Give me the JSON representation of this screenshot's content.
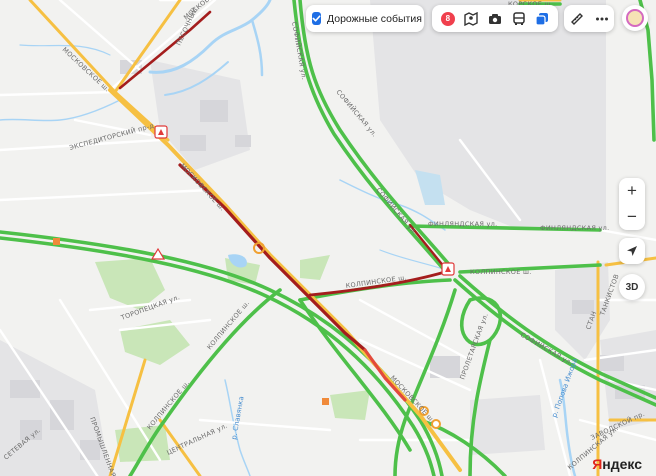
{
  "map": {
    "street_labels": {
      "moskovskoe_1": "МОСКОВСКОЕ ш.",
      "moskovskoe_2": "МОСКОВСКОЕ ш.",
      "moskovskoe_3": "МОСКОВСКОЕ ш.",
      "moskovskoe_top": "МОСКОВСКОЕ",
      "pesochny": "ПЕСОЧНЫЙ",
      "sofiyskaya_1": "СОФИЙСКАЯ ул.",
      "sofiyskaya_2": "СОФИЙСКАЯ ул.",
      "sofiyskaya_3": "СОФИЙСКАЯ ул.",
      "sofiyskaya_4": "СОФИЙСКАЯ ул.",
      "finlyandskaya": "ФИНЛЯНДСКАЯ ул.",
      "finlyandskaya_2": "ФИНЛЯНДСКАЯ ул.",
      "kolpinskoe_1": "КОЛПИНСКОЕ ш.",
      "kolpinskoe_2": "КОЛПИНСКОЕ ш.",
      "kolpinskoe_3": "КОЛПИНСКОЕ ш.",
      "kolpinskoe_4": "КОЛПИНСКОЕ ш.",
      "ekspeditorsky": "ЭКСПЕДИТОРСКИЙ пр-д",
      "toropetskaya": "ТОРОПЕЦКАЯ ул.",
      "promyshlennaya": "ПРОМЫШЛЕННАЯ ул.",
      "setevaya": "СЕТЕВАЯ ул.",
      "proletarskaya": "ПРОЛЕТАРСКАЯ ул.",
      "zavodskoy": "ЗАВОДСКОЙ пр.",
      "lokhanski": "КОЛПИНСКАЯ ул.",
      "tsentralnaya": "ЦЕНТРАЛЬНАЯ ул.",
      "rosh": "КОРСКОЕ ш.",
      "tankistov": "ТАНКИСТОВ",
      "stan": "СТАН"
    },
    "water_labels": {
      "slavyanka": "р. Славянка",
      "popova": "р. Попова Ижора"
    }
  },
  "toolbar": {
    "traffic_events_label": "Дорожные события",
    "traffic_events_checked": true,
    "traffic_score": "8",
    "layers": [
      "panorama-icon",
      "camera-icon",
      "bus-icon",
      "layers-icon"
    ],
    "tools": [
      "ruler-icon",
      "more-icon"
    ]
  },
  "controls": {
    "zoom_in": "+",
    "zoom_out": "−",
    "btn_3d": "3D"
  },
  "logo": {
    "first": "Я",
    "rest": "ндекс"
  },
  "colors": {
    "traffic_free": "#4ec04a",
    "traffic_medium": "#f6c042",
    "traffic_jam": "#a41d1d",
    "accent": "#1e6ee5",
    "water": "#a8d4f5"
  }
}
